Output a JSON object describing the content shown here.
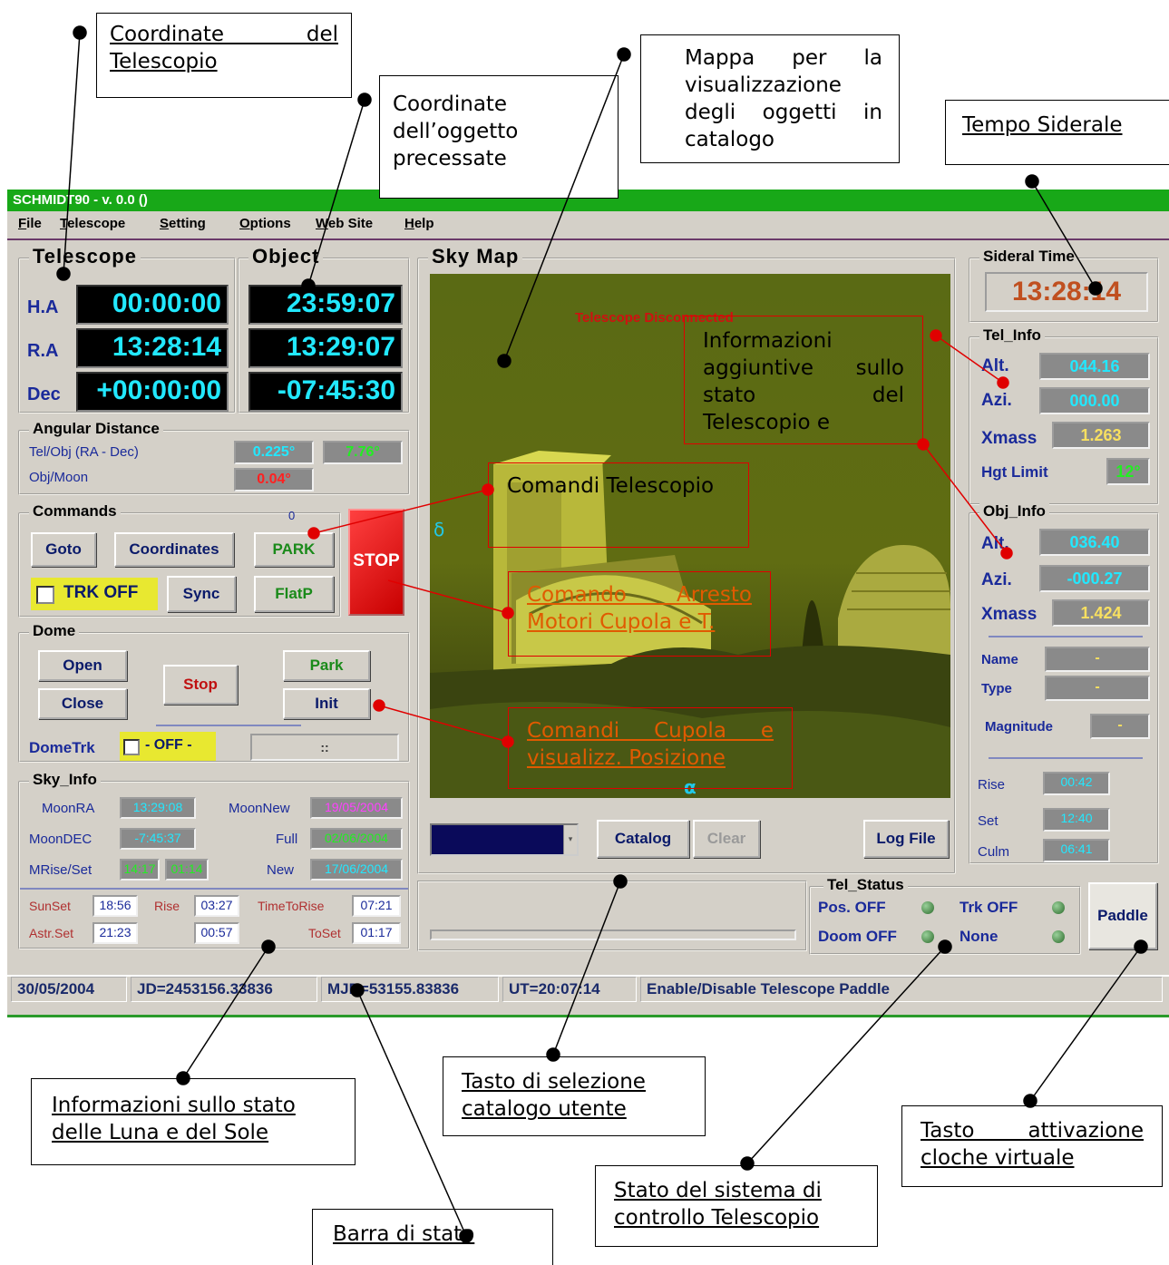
{
  "window": {
    "title": "SCHMIDT90 - v. 0.0  ()"
  },
  "menu": [
    "File",
    "Telescope",
    "Setting",
    "Options",
    "Web Site",
    "Help"
  ],
  "telescope": {
    "label": "Telescope",
    "rows": [
      {
        "label": "H.A",
        "value": "00:00:00"
      },
      {
        "label": "R.A",
        "value": "13:28:14"
      },
      {
        "label": "Dec",
        "value": "+00:00:00"
      }
    ]
  },
  "object": {
    "label": "Object",
    "values": [
      "23:59:07",
      "13:29:07",
      "-07:45:30"
    ]
  },
  "angular": {
    "label": "Angular Distance",
    "row1": "Tel/Obj  (RA - Dec)",
    "row2": "Obj/Moon",
    "ra": "0.225°",
    "dec": "7.76°",
    "moon": "0.04°"
  },
  "commands": {
    "label": "Commands",
    "counter": "0",
    "goto": "Goto",
    "coordinates": "Coordinates",
    "park": "PARK",
    "trk": "TRK OFF",
    "sync": "Sync",
    "flatp": "FlatP",
    "stop": "STOP"
  },
  "dome": {
    "label": "Dome",
    "open": "Open",
    "close": "Close",
    "stop": "Stop",
    "park": "Park",
    "init": "Init",
    "trk_label": "DomeTrk",
    "trk_value": "- OFF -",
    "position": "::"
  },
  "sky_info": {
    "label": "Sky_Info",
    "moon_ra_label": "MoonRA",
    "moon_ra": "13:29:08",
    "moon_new_label": "MoonNew",
    "moon_new": "19/05/2004",
    "moon_dec_label": "MoonDEC",
    "moon_dec": "-7:45:37",
    "full_label": "Full",
    "full": "02/06/2004",
    "mrise_label": "MRise/Set",
    "mrise": "14:17",
    "mset": "01:14",
    "new_label": "New",
    "new": "17/06/2004",
    "sunset_label": "SunSet",
    "sunset": "18:56",
    "rise_label": "Rise",
    "rise": "03:27",
    "ttr_label": "TimeToRise",
    "ttr": "07:21",
    "astr_label": "Astr.Set",
    "astr": "21:23",
    "astr2": "00:57",
    "toset_label": "ToSet",
    "toset": "01:17"
  },
  "skymap": {
    "label": "Sky Map",
    "disconnected": "Telescope Disconnected",
    "delta": "δ",
    "alpha": "α",
    "catalog": "Catalog",
    "clear": "Clear",
    "logfile": "Log File"
  },
  "sidereal": {
    "label": "Sideral Time",
    "value": "13:28:14"
  },
  "tel_info": {
    "label": "Tel_Info",
    "alt_label": "Alt.",
    "alt": "044.16",
    "azi_label": "Azi.",
    "azi": "000.00",
    "xmass_label": "Xmass",
    "xmass": "1.263",
    "hgt_label": "Hgt Limit",
    "hgt": "12°"
  },
  "obj_info": {
    "label": "Obj_Info",
    "alt_label": "Alt.",
    "alt": "036.40",
    "azi_label": "Azi.",
    "azi": "-000.27",
    "xmass_label": "Xmass",
    "xmass": "1.424",
    "name_label": "Name",
    "name": "-",
    "type_label": "Type",
    "type": "-",
    "mag_label": "Magnitude",
    "mag": "-",
    "rise_label": "Rise",
    "rise": "00:42",
    "set_label": "Set",
    "set": "12:40",
    "culm_label": "Culm",
    "culm": "06:41"
  },
  "tel_status": {
    "label": "Tel_Status",
    "pos": "Pos. OFF",
    "trk": "Trk OFF",
    "doom": "Doom OFF",
    "none": "None",
    "paddle": "Paddle"
  },
  "statusbar": [
    "30/05/2004",
    "JD=2453156.33836",
    "MJD=53155.83836",
    "UT=20:07:14",
    "Enable/Disable Telescope Paddle"
  ],
  "notes": {
    "coord_tel": "Coordinate del Telescopio",
    "coord_obj": "Coordinate dell’oggetto precessate",
    "mappa": "Mappa per la visualizzazione degli oggetti in catalogo",
    "tempo": "Tempo Siderale",
    "info_agg": "Informazioni aggiuntive sullo stato del Telescopio e",
    "comandi_tel": "Comandi Telescopio",
    "arresto": "Comando Arresto Motori Cupola e T.",
    "cupola": "Comandi Cupola e visualizz. Posizione",
    "luna_sole": "Informazioni sullo stato delle Luna e del Sole",
    "catalogo": "Tasto di selezione catalogo utente",
    "cloche": "Tasto attivazione cloche virtuale",
    "stato_sistema": "Stato del sistema di controllo Telescopio",
    "barra": "Barra di stato"
  }
}
